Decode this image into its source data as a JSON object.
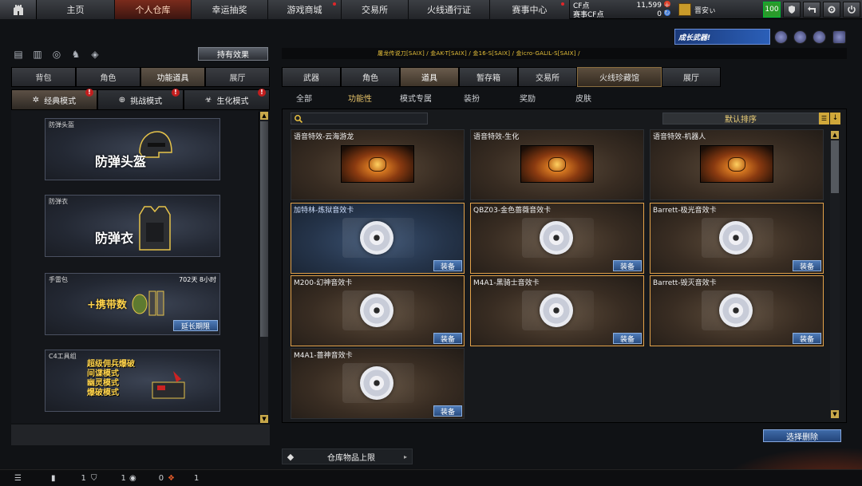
{
  "topnav": {
    "tabs": [
      "主页",
      "个人仓库",
      "幸运抽奖",
      "游戏商城",
      "交易所",
      "火线通行证",
      "赛事中心"
    ],
    "active_tab": "个人仓库"
  },
  "currency": {
    "cf_label": "CF点",
    "cf_value": "11,599",
    "event_cf_label": "赛事CF点",
    "event_cf_value": "0"
  },
  "user": {
    "name": "晋安ぃ",
    "level": "100"
  },
  "left": {
    "tabs": [
      "背包",
      "角色",
      "功能道具",
      "展厅"
    ],
    "active_tab": "功能道具",
    "effect_button": "持有效果",
    "modes": [
      "经典模式",
      "挑战模式",
      "生化模式"
    ],
    "active_mode": "经典模式",
    "items": [
      {
        "title": "防弹头盔",
        "big": "防弹头盔"
      },
      {
        "title": "防弹衣",
        "big": "防弹衣"
      },
      {
        "title": "手雷包",
        "big": "+携带数",
        "time": "702天 8小时",
        "button": "延长期限"
      },
      {
        "title": "C4工具组",
        "lines": [
          "超级佣兵爆破",
          "间谍模式",
          "幽灵模式",
          "爆破模式"
        ]
      }
    ]
  },
  "banner": {
    "text": "成长武器!"
  },
  "trail": "屠龙传说刀[SAIX] / 金AK-T[SAIX] / 金16-S[SAIX] / 金icro-GALIL-S[SAIX] /",
  "categories": [
    "武器",
    "角色",
    "道具",
    "暂存箱",
    "交易所",
    "火线珍藏馆",
    "展厅"
  ],
  "active_category": "道具",
  "subtabs": [
    "全部",
    "功能性",
    "模式专属",
    "装扮",
    "奖励",
    "皮肤"
  ],
  "active_subtab": "功能性",
  "sort": {
    "label": "默认排序"
  },
  "grid": {
    "equip_label": "装备",
    "items": [
      {
        "title": "语音特效-云海游龙",
        "kind": "voice"
      },
      {
        "title": "语音特效-生化",
        "kind": "voice"
      },
      {
        "title": "语音特效-机器人",
        "kind": "voice"
      },
      {
        "title": "加特林-炼狱音效卡",
        "kind": "disc",
        "selected": true
      },
      {
        "title": "QBZ03-金色蔷薇音效卡",
        "kind": "disc"
      },
      {
        "title": "Barrett-极光音效卡",
        "kind": "disc"
      },
      {
        "title": "M200-幻神音效卡",
        "kind": "disc"
      },
      {
        "title": "M4A1-黑骑士音效卡",
        "kind": "disc"
      },
      {
        "title": "Barrett-毁灭音效卡",
        "kind": "disc"
      },
      {
        "title": "M4A1-蔷神音效卡",
        "kind": "disc"
      }
    ]
  },
  "select_delete": "选择删除",
  "warehouse_limit": "仓库物品上限",
  "statusbar": {
    "count1": "1",
    "count2": "1",
    "count3": "0",
    "count4": "1"
  }
}
